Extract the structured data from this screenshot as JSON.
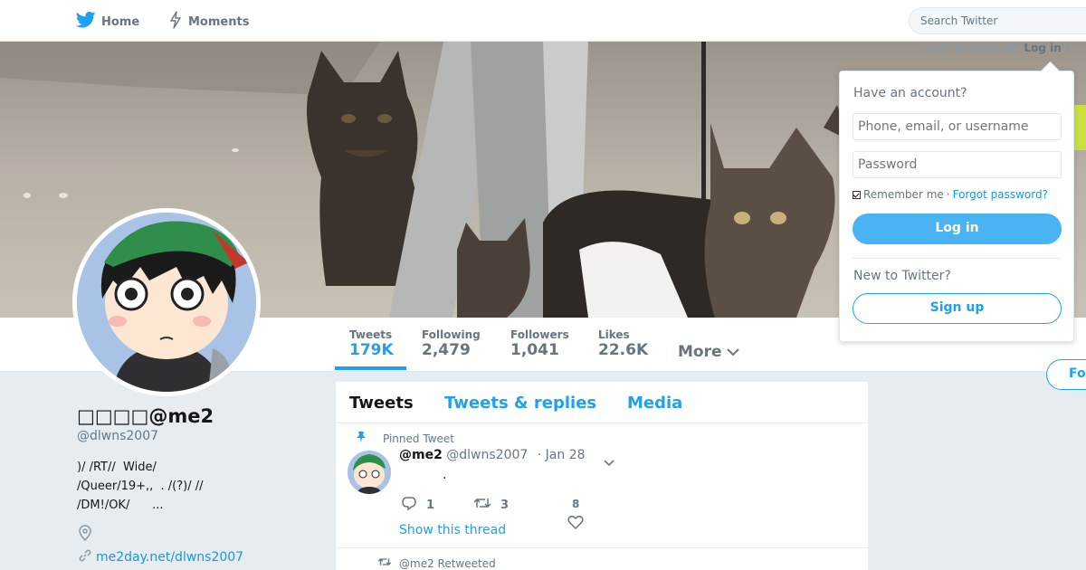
{
  "colors": {
    "brand": "#1da1f2",
    "link": "#1b95e0",
    "background": "#e6ecf0"
  },
  "nav": {
    "home_label": "Home",
    "moments_label": "Moments",
    "search_placeholder": "Search Twitter",
    "have_account_text": "Have an account?",
    "login_label": "Log in"
  },
  "profile": {
    "name": "□□□□@me2",
    "handle": "@dlwns2007",
    "bio": ")/ /RT//  Wide/\n/Queer/19+,,  . /(?)/ //\n/DM!/OK/      ...",
    "link": "me2day.net/dlwns2007"
  },
  "stats": [
    {
      "label": "Tweets",
      "value": "179K"
    },
    {
      "label": "Following",
      "value": "2,479"
    },
    {
      "label": "Followers",
      "value": "1,041"
    },
    {
      "label": "Likes",
      "value": "22.6K"
    }
  ],
  "more_label": "More",
  "follow_label": "Fo",
  "timeline": {
    "tabs": [
      "Tweets",
      "Tweets & replies",
      "Media"
    ],
    "pinned_label": "Pinned Tweet",
    "tweet": {
      "name": "@me2",
      "handle": "@dlwns2007",
      "date": "· Jan 28",
      "text": ".",
      "replies": "1",
      "retweets": "3",
      "likes": "8",
      "thread_link": "Show this thread"
    },
    "retweeted_label": "@me2 Retweeted"
  },
  "login_panel": {
    "title": "Have an account?",
    "username_placeholder": "Phone, email, or username",
    "password_placeholder": "Password",
    "remember_label": "Remember me",
    "separator": "·",
    "forgot_label": "Forgot password?",
    "login_button": "Log in",
    "new_prompt": "New to Twitter?",
    "signup_button": "Sign up"
  }
}
